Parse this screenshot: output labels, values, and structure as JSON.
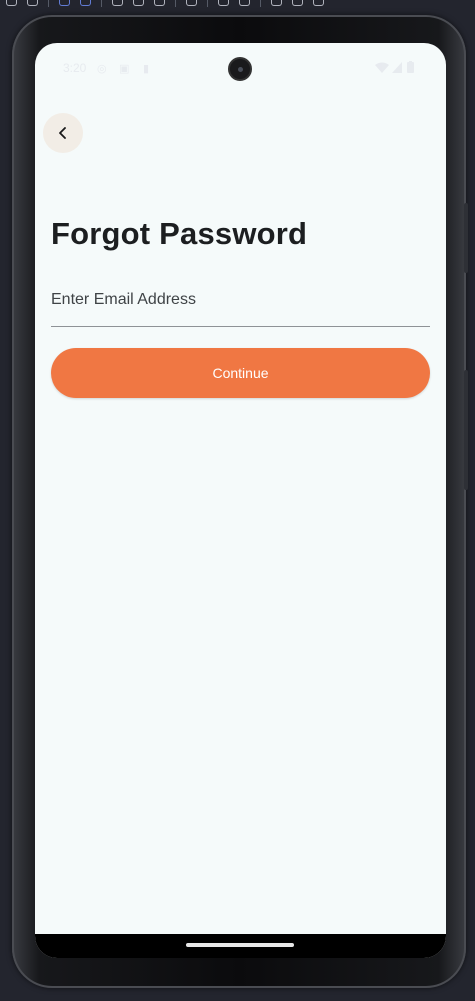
{
  "status_bar": {
    "time": "3:20",
    "icons": [
      "location-icon",
      "notification-icon",
      "sim-icon",
      "wifi-icon",
      "signal-icon",
      "battery-icon"
    ]
  },
  "header": {
    "back_icon": "chevron-left-icon"
  },
  "main": {
    "title": "Forgot Password",
    "email_placeholder": "Enter Email Address",
    "email_value": "",
    "continue_label": "Continue"
  },
  "colors": {
    "background": "#f5fafa",
    "accent": "#f07743",
    "title_text": "#1c1e20"
  }
}
